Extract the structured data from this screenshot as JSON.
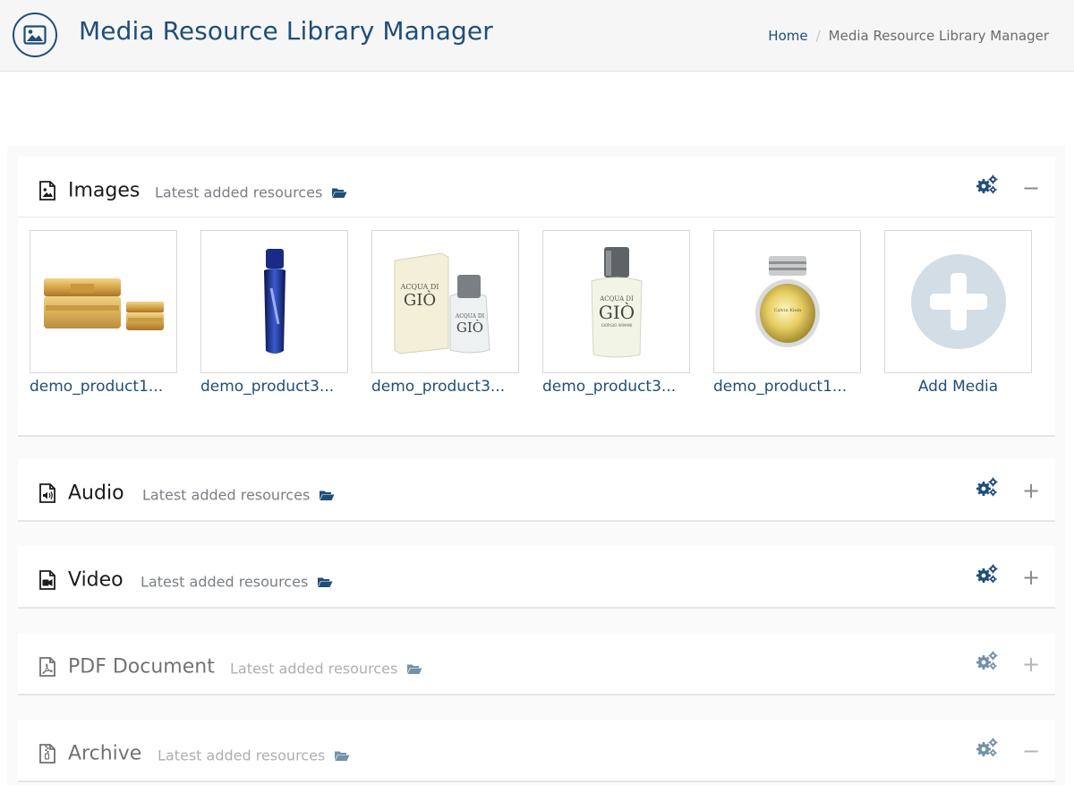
{
  "header": {
    "title": "Media Resource Library Manager",
    "app_icon": "image-icon",
    "breadcrumb": {
      "home": "Home",
      "separator": "/",
      "current": "Media Resource Library Manager"
    }
  },
  "panels": [
    {
      "title": "Images",
      "subtitle": "Latest added resources",
      "icon": "file-image-icon",
      "toggle": "−",
      "expanded": true,
      "items": [
        {
          "label": "demo_product1...",
          "thumb": "cream-jars"
        },
        {
          "label": "demo_product3...",
          "thumb": "blue-perfume-bottle"
        },
        {
          "label": "demo_product3...",
          "thumb": "acqua-di-gio-box"
        },
        {
          "label": "demo_product3...",
          "thumb": "acqua-di-gio-bottle"
        },
        {
          "label": "demo_product1...",
          "thumb": "gold-perfume-bottle"
        },
        {
          "label": "Add Media",
          "thumb": "plus-circle-icon"
        }
      ]
    },
    {
      "title": "Audio",
      "subtitle": "Latest added resources",
      "icon": "file-audio-icon",
      "toggle": "+",
      "expanded": false
    },
    {
      "title": "Video",
      "subtitle": "Latest added resources",
      "icon": "file-video-icon",
      "toggle": "+",
      "expanded": false
    },
    {
      "title": "PDF Document",
      "subtitle": "Latest added resources",
      "icon": "file-pdf-icon",
      "toggle": "+",
      "expanded": false
    },
    {
      "title": "Archive",
      "subtitle": "Latest added resources",
      "icon": "file-archive-icon",
      "toggle": "−",
      "expanded": false
    }
  ],
  "colors": {
    "brand": "#1f4e79",
    "muted_text": "#7a7f85",
    "add_media_circle": "#d3dde6"
  }
}
